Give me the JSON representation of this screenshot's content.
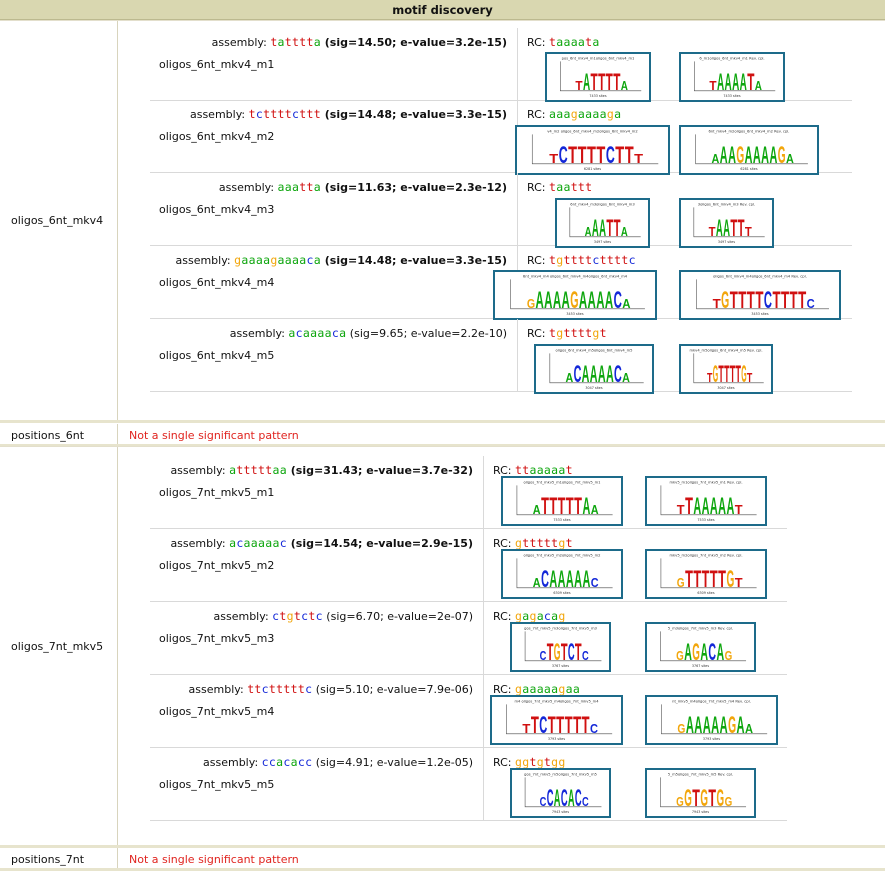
{
  "header": {
    "title": "motif discovery"
  },
  "sections": [
    {
      "label": "oligos_6nt_mkv4",
      "motifs": [
        {
          "name": "oligos_6nt_mkv4_m1",
          "assembly_label": "assembly:",
          "seq": "tatttta",
          "stats": "(sig=14.50; e-value=3.2e-15)",
          "bold": true,
          "rc_label": "RC:",
          "rc_seq": "taaaata",
          "logo_title": "pos_6nt_mkv4_m1oligos_6nt_mkv4_m1",
          "rc_logo_title": "6_m1oligos_6nt_mkv4_m1 Rev. cpl.",
          "sites": "7433 sites",
          "rc_sites": "7433 sites"
        },
        {
          "name": "oligos_6nt_mkv4_m2",
          "assembly_label": "assembly:",
          "seq": "tcttttcttt",
          "stats": "(sig=14.48; e-value=3.3e-15)",
          "bold": true,
          "rc_label": "RC:",
          "rc_seq": "aaagaaaaga",
          "logo_title": "v4_m2 oligos_6nt_mkv4_m2oligos_6nt_mkv4_m2",
          "rc_logo_title": "6nt_mkv4_m2oligos_6nt_mkv4_m2 Rev. cpl.",
          "sites": "6281 sites",
          "rc_sites": "6281 sites"
        },
        {
          "name": "oligos_6nt_mkv4_m3",
          "assembly_label": "assembly:",
          "seq": "aaatta",
          "stats": "(sig=11.63; e-value=2.3e-12)",
          "bold": true,
          "rc_label": "RC:",
          "rc_seq": "taattt",
          "logo_title": "6nt_mkv4_m3oligos_6nt_mkv4_m3",
          "rc_logo_title": "3oligos_6nt_mkv4_m3 Rev. cpl.",
          "sites": "3497 sites",
          "rc_sites": "3497 sites"
        },
        {
          "name": "oligos_6nt_mkv4_m4",
          "assembly_label": "assembly:",
          "seq": "gaaaagaaaaca",
          "stats": "(sig=14.48; e-value=3.3e-15)",
          "bold": true,
          "rc_label": "RC:",
          "rc_seq": "tgttttcttttc",
          "logo_title": "6nt_mkv4_m4 oligos_6nt_mkv4_m4oligos_6nt_mkv4_m4",
          "rc_logo_title": "oligos_6nt_mkv4_m4oligos_6nt_mkv4_m4 Rev. cpl.",
          "sites": "3453 sites",
          "rc_sites": "3453 sites"
        },
        {
          "name": "oligos_6nt_mkv4_m5",
          "assembly_label": "assembly:",
          "seq": "acaaaaca",
          "stats": "(sig=9.65; e-value=2.2e-10)",
          "bold": false,
          "rc_label": "RC:",
          "rc_seq": "tgttttgt",
          "logo_title": "oligos_6nt_mkv4_m5oligos_6nt_mkv4_m5",
          "rc_logo_title": "mkv4_m5oligos_6nt_mkv4_m5 Rev. cpl.",
          "sites": "3047 sites",
          "rc_sites": "3047 sites"
        }
      ]
    },
    {
      "label": "oligos_7nt_mkv5",
      "motifs": [
        {
          "name": "oligos_7nt_mkv5_m1",
          "assembly_label": "assembly:",
          "seq": "atttttaa",
          "stats": "(sig=31.43; e-value=3.7e-32)",
          "bold": true,
          "rc_label": "RC:",
          "rc_seq": "ttaaaaat",
          "logo_title": "oligos_7nt_mkv5_m1oligos_7nt_mkv5_m1",
          "rc_logo_title": "mkv5_m1oligos_7nt_mkv5_m1 Rev. cpl.",
          "sites": "7533 sites",
          "rc_sites": "7533 sites"
        },
        {
          "name": "oligos_7nt_mkv5_m2",
          "assembly_label": "assembly:",
          "seq": "acaaaaac",
          "stats": "(sig=14.54; e-value=2.9e-15)",
          "bold": true,
          "rc_label": "RC:",
          "rc_seq": "gtttttgt",
          "logo_title": "oligos_7nt_mkv5_m2oligos_7nt_mkv5_m2",
          "rc_logo_title": "mkv5_m2oligos_7nt_mkv5_m2 Rev. cpl.",
          "sites": "6309 sites",
          "rc_sites": "6309 sites"
        },
        {
          "name": "oligos_7nt_mkv5_m3",
          "assembly_label": "assembly:",
          "seq": "ctgtctc",
          "stats": "(sig=6.70; e-value=2e-07)",
          "bold": false,
          "rc_label": "RC:",
          "rc_seq": "gagacag",
          "logo_title": "gos_7nt_mkv5_m3oligos_7nt_mkv5_m3",
          "rc_logo_title": "5_m3oligos_7nt_mkv5_m3 Rev. cpl.",
          "sites": "3767 sites",
          "rc_sites": "3767 sites"
        },
        {
          "name": "oligos_7nt_mkv5_m4",
          "assembly_label": "assembly:",
          "seq": "ttctttttc",
          "stats": "(sig=5.10; e-value=7.9e-06)",
          "bold": false,
          "rc_label": "RC:",
          "rc_seq": "gaaaaagaa",
          "logo_title": "m4 oligos_7nt_mkv5_m4oligos_7nt_mkv5_m4",
          "rc_logo_title": "nt_mkv5_m4oligos_7nt_mkv5_m4 Rev. cpl.",
          "sites": "3793 sites",
          "rc_sites": "3793 sites"
        },
        {
          "name": "oligos_7nt_mkv5_m5",
          "assembly_label": "assembly:",
          "seq": "ccacacc",
          "stats": "(sig=4.91; e-value=1.2e-05)",
          "bold": false,
          "rc_label": "RC:",
          "rc_seq": "ggtgtgg",
          "logo_title": "gos_7nt_mkv5_m5oligos_7nt_mkv5_m5",
          "rc_logo_title": "5_m5oligos_7nt_mkv5_m5 Rev. cpl.",
          "sites": "7943 sites",
          "rc_sites": "7943 sites"
        }
      ]
    }
  ],
  "no_pattern_rows": [
    {
      "label": "positions_6nt",
      "message": "Not a single significant pattern"
    },
    {
      "label": "positions_7nt",
      "message": "Not a single significant pattern"
    }
  ],
  "colors": {
    "a": "#0ea60e",
    "c": "#1428d8",
    "g": "#f2a60c",
    "t": "#d01010",
    "logo_border": "#1d6b8a",
    "header_bg": "#d9d7b0",
    "error_text": "#e0241f"
  }
}
